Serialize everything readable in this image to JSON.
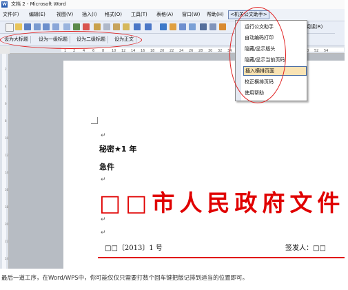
{
  "window": {
    "title": "文档 2 - Microsoft Word",
    "app_icon": "W"
  },
  "menubar": {
    "items": [
      "文件(F)",
      "编辑(E)",
      "视图(V)",
      "插入(I)",
      "格式(O)",
      "工具(T)",
      "表格(A)",
      "窗口(W)",
      "帮助(H)"
    ],
    "assistant_menu": "<机关公文助手>"
  },
  "toolbar1": {
    "reading_label": "阅读(R)"
  },
  "toolbar2": {
    "buttons": [
      "设为大标题",
      "设为一级标题",
      "设为二级标题",
      "设为正文"
    ]
  },
  "assistant_dropdown": {
    "items": [
      "运行公文助手",
      "自动编码打印",
      "隐藏/显示版头",
      "隐藏/显示当前页码",
      "插入横排页面",
      "校正横排页码",
      "使用帮助"
    ],
    "highlighted_index": 4
  },
  "ruler": {
    "ticks": [
      "1",
      "2",
      "4",
      "6",
      "8",
      "10",
      "12",
      "14",
      "16",
      "18",
      "20",
      "22",
      "24",
      "26",
      "28",
      "30",
      "32",
      "34",
      "36",
      "38",
      "40",
      "42",
      "44",
      "46",
      "48",
      "50",
      "52",
      "54"
    ]
  },
  "vruler": {
    "ticks": [
      "2",
      "4",
      "6",
      "8",
      "10",
      "12",
      "14",
      "16",
      "18",
      "20",
      "22",
      "24"
    ]
  },
  "document": {
    "paragraph_mark": "↵",
    "secret_level": "秘密★1 年",
    "urgency": "急件",
    "title": "□□市人民政府文件",
    "doc_number": "□□〔2013〕1 号",
    "signer": "签发人：□□"
  },
  "caption": "最后一道工序，在Word/WPS中，你可能仅仅只需要打数个回车键把版记排到适当的位置即可。",
  "colors": {
    "document_red": "#e00000",
    "annotation_red": "#e02020",
    "menu_highlight": "#f9e3b4"
  }
}
